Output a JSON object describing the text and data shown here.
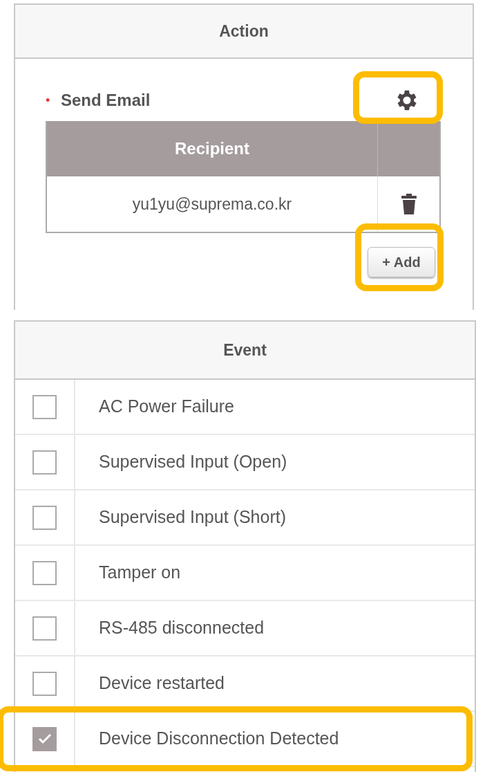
{
  "action_panel": {
    "title": "Action",
    "required_marker": "•",
    "send_email": {
      "label": "Send Email",
      "settings_highlighted": true,
      "table": {
        "columns": [
          "Recipient"
        ],
        "rows": [
          {
            "recipient": "yu1yu@suprema.co.kr"
          }
        ]
      },
      "add_button": {
        "label": "+ Add",
        "highlighted": true
      }
    }
  },
  "event_panel": {
    "title": "Event",
    "events": [
      {
        "label": "AC Power Failure",
        "checked": false,
        "highlighted": false
      },
      {
        "label": "Supervised Input (Open)",
        "checked": false,
        "highlighted": false
      },
      {
        "label": "Supervised Input (Short)",
        "checked": false,
        "highlighted": false
      },
      {
        "label": "Tamper on",
        "checked": false,
        "highlighted": false
      },
      {
        "label": "RS-485 disconnected",
        "checked": false,
        "highlighted": false
      },
      {
        "label": "Device restarted",
        "checked": false,
        "highlighted": false
      },
      {
        "label": "Device Disconnection Detected",
        "checked": true,
        "highlighted": true
      }
    ]
  }
}
